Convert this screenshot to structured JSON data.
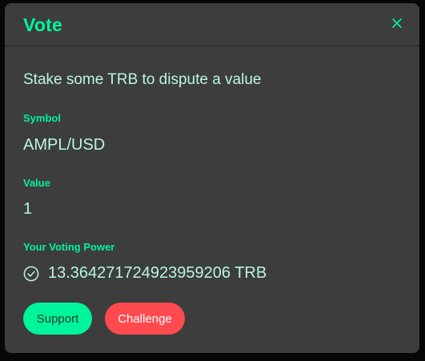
{
  "modal": {
    "title": "Vote",
    "close_label": "X",
    "subtitle": "Stake some TRB to dispute a value",
    "fields": {
      "symbol_label": "Symbol",
      "symbol_value": "AMPL/USD",
      "value_label": "Value",
      "value_value": "1",
      "power_label": "Your Voting Power",
      "power_value": "13.364271724923959206 TRB"
    },
    "buttons": {
      "support_label": "Support",
      "challenge_label": "Challenge"
    },
    "icons": {
      "close": "close-icon",
      "power": "check-circle-icon"
    },
    "colors": {
      "accent": "#00f49b",
      "danger": "#ff4a4f",
      "text": "#b8f6df",
      "panel": "#3d3d3d"
    }
  }
}
